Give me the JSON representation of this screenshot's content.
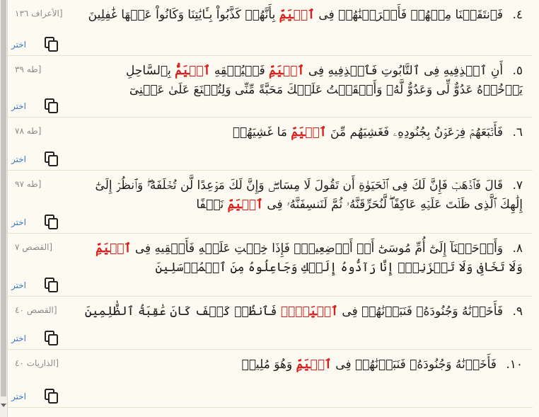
{
  "list": {
    "rows": [
      {
        "num": "٤.",
        "ref": "[الأعراف ١٣٦",
        "pre": "فَٱنتَقَمۡنَا مِنۡهُمۡ فَأَغۡرَقۡنَٰهُمۡ فِى",
        "hl": "ٱلۡيَمِّ",
        "post": "بِأَنَّهُمۡ كَذَّبُواْ بِـَٔايَٰتِنَا وَكَانُواْ عَنۡهَا غَٰفِلِينَ",
        "choose": "اختر"
      },
      {
        "num": "٥.",
        "ref": "[طه ٣٩",
        "pre": "أَنِ ٱقۡذِفِيهِ فِى ٱلتَّابُوتِ فَٱقۡذِفِيهِ فِى",
        "hl": "ٱلۡيَمِّ",
        "mid": "فَلۡيُلۡقِهِ",
        "hl2": "ٱلۡيَمُّ",
        "post": "بِٱلسَّاحِلِ يَأۡخُذۡهُ عَدُوٌّ لِّى وَعَدُوٌّ لَّهُۥ وَأَلۡقَيۡتُ عَلَيۡكَ مَحَبَّةً مِّنِّى وَلِتُصۡنَعَ عَلَىٰ عَيۡنِىٓ",
        "choose": "اختر"
      },
      {
        "num": "٦.",
        "ref": "[طه ٧٨",
        "pre": "فَأَتۡبَعَهُمۡ فِرۡعَوۡنُ بِجُنُودِهِۦ فَغَشِيَهُم مِّنَ",
        "hl": "ٱلۡيَمِّ",
        "post": "مَا غَشِيَهُمۡ",
        "choose": "اختر"
      },
      {
        "num": "٧.",
        "ref": "[طه ٩٧",
        "pre": "قَالَ فَٱذۡهَبۡ فَإِنَّ لَكَ فِى ٱلۡحَيَوٰةِ أَن تَقُولَ لَا مِسَاسَۖ وَإِنَّ لَكَ مَوۡعِدًا لَّن تُخۡلَفَهُۥۖ وَٱنظُرۡ إِلَىٰٓ إِلَٰهِكَ ٱلَّذِى ظَلۡتَ عَلَيۡهِ عَاكِفًاۖ لَّنُحَرِّقَنَّهُۥ ثُمَّ لَنَنسِفَنَّهُۥ فِى",
        "hl": "ٱلۡيَمِّ",
        "post": "نَسۡفًا",
        "choose": "اختر"
      },
      {
        "num": "٨.",
        "ref": "[القصص ٧",
        "pre": "وَأَوۡحَيۡنَآ إِلَىٰٓ أُمِّ مُوسَىٰٓ أَنۡ أَرۡضِعِيهِۖ فَإِذَا خِفۡتِ عَلَيۡهِ فَأَلۡقِيهِ فِى",
        "hl": "ٱلۡيَمِّ",
        "post": "وَلَا تَخَافِى وَلَا تَحۡزَنِىٓۖ إِنَّا رَآدُّوهُ إِلَيۡكِ وَجَاعِلُوهُ مِنَ ٱلۡمُرۡسَلِينَ",
        "choose": "اختر"
      },
      {
        "num": "٩.",
        "ref": "[القصص ٤٠",
        "pre": "فَأَخَذۡنَٰهُ وَجُنُودَهُۥ فَنَبَذۡنَٰهُمۡ فِى",
        "hl": "ٱلۡيَمِّۖ",
        "post": "فَٱنظُرۡ كَيۡفَ كَانَ عَٰقِبَةُ ٱلظَّٰلِمِينَ",
        "choose": "اختر"
      },
      {
        "num": "١٠.",
        "ref": "[الذاريات ٤٠",
        "pre": "فَأَخَذۡنَٰهُ وَجُنُودَهُۥ فَنَبَذۡنَٰهُمۡ فِى",
        "hl": "ٱلۡيَمِّ",
        "post": "وَهُوَ مُلِيمٞ",
        "choose": "اختر"
      }
    ]
  }
}
